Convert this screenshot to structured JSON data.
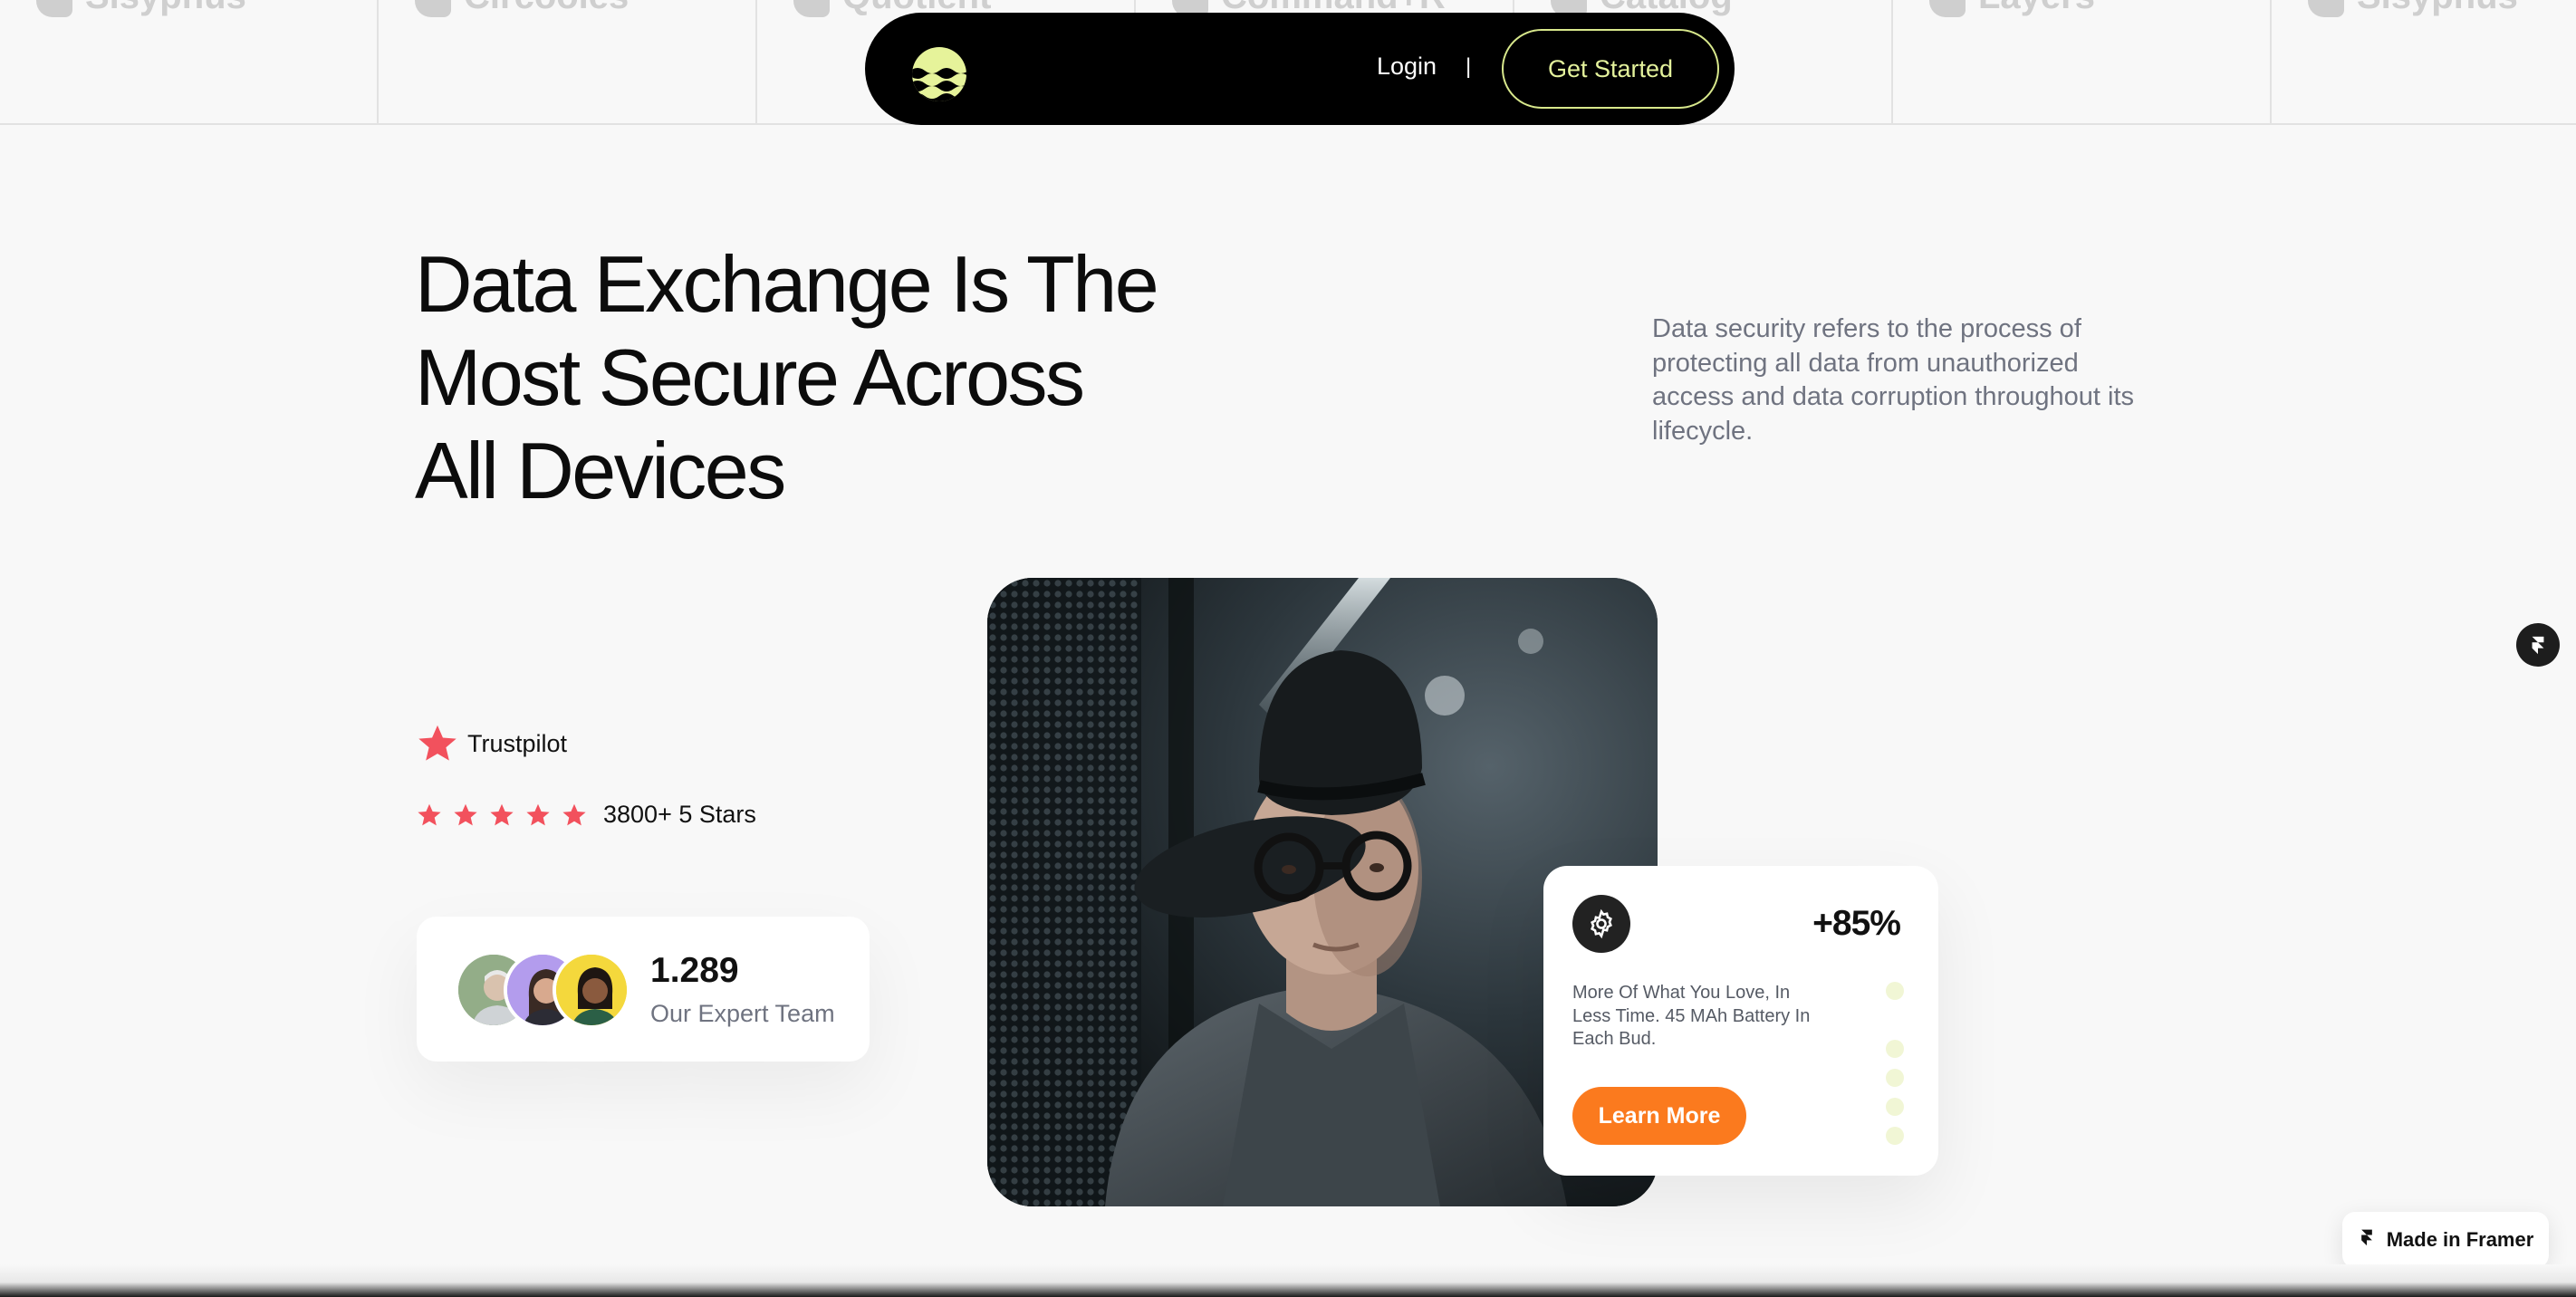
{
  "logo_strip": [
    {
      "name": "Sisyphus"
    },
    {
      "name": "Circooles"
    },
    {
      "name": "Quotient"
    },
    {
      "name": "Command+R"
    },
    {
      "name": "Catalog"
    },
    {
      "name": "Layers"
    },
    {
      "name": "Sisyphus"
    }
  ],
  "nav": {
    "logo_icon": "waves-sun-icon",
    "login_label": "Login",
    "separator": "|",
    "cta_label": "Get Started"
  },
  "hero": {
    "headline_lines": [
      "Data Exchange Is The",
      "Most Secure Across",
      "All Devices"
    ],
    "subtext": "Data security refers to the process of protecting all data from unauthorized access and data corruption throughout its lifecycle."
  },
  "trustpilot": {
    "label": "Trustpilot",
    "rating_text": "3800+ 5 Stars",
    "stars": 5,
    "star_color": "#f2515d"
  },
  "team": {
    "count": "1.289",
    "label": "Our Expert Team"
  },
  "stat_card": {
    "value": "+85%",
    "description": "More Of What You Love, In Less Time. 45 MAh Battery In Each Bud.",
    "button_label": "Learn More",
    "button_color": "#fb7a1e"
  },
  "framer_badge": {
    "label": "Made in Framer"
  }
}
